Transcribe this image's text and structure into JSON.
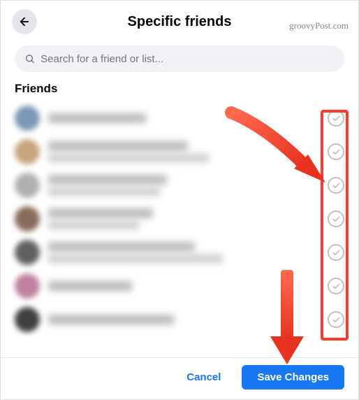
{
  "header": {
    "title": "Specific friends"
  },
  "watermark": "groovyPost.com",
  "search": {
    "placeholder": "Search for a friend or list..."
  },
  "section": {
    "title": "Friends"
  },
  "friends": [
    {
      "avatarColor": "#7a98b8",
      "line1Width": "140px",
      "line2Width": "0px"
    },
    {
      "avatarColor": "#c9a37a",
      "line1Width": "200px",
      "line2Width": "230px"
    },
    {
      "avatarColor": "#b0b0b0",
      "line1Width": "170px",
      "line2Width": "160px"
    },
    {
      "avatarColor": "#8a6a5a",
      "line1Width": "150px",
      "line2Width": "130px"
    },
    {
      "avatarColor": "#606060",
      "line1Width": "210px",
      "line2Width": "250px"
    },
    {
      "avatarColor": "#c080a0",
      "line1Width": "120px",
      "line2Width": "0px"
    },
    {
      "avatarColor": "#404040",
      "line1Width": "180px",
      "line2Width": "0px"
    }
  ],
  "footer": {
    "cancel": "Cancel",
    "save": "Save Changes"
  }
}
